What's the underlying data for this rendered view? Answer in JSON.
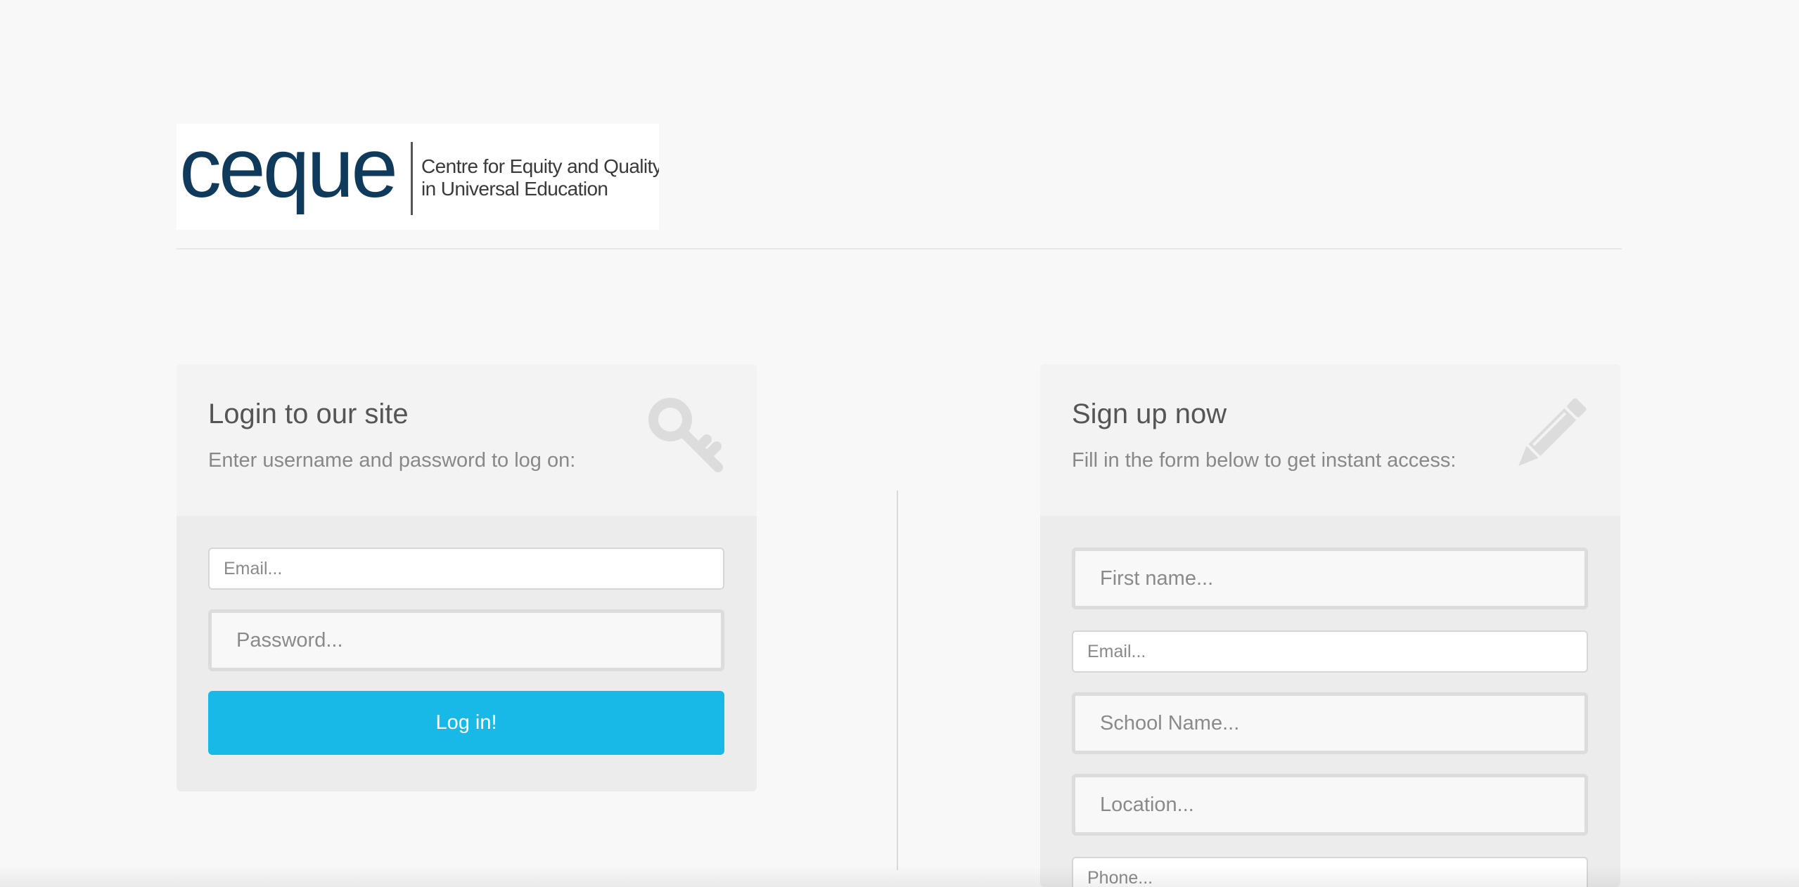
{
  "logo": {
    "wordmark": "ceque",
    "tagline_line1": "Centre for Equity and Quality",
    "tagline_line2": "in Universal Education",
    "brand_color": "#0f3a5c"
  },
  "login": {
    "title": "Login to our site",
    "description": "Enter username and password to log on:",
    "icon": "key-icon",
    "email_placeholder": "Email...",
    "password_placeholder": "Password...",
    "submit_label": "Log in!",
    "button_color": "#19b9e7"
  },
  "signup": {
    "title": "Sign up now",
    "description": "Fill in the form below to get instant access:",
    "icon": "pencil-icon",
    "first_name_placeholder": "First name...",
    "email_placeholder": "Email...",
    "school_placeholder": "School Name...",
    "location_placeholder": "Location...",
    "phone_placeholder": "Phone..."
  }
}
